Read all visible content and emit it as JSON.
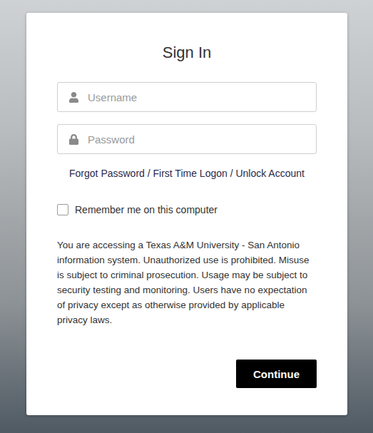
{
  "title": "Sign In",
  "fields": [
    {
      "placeholder": "Username",
      "kind": "user"
    },
    {
      "placeholder": "Password",
      "kind": "password"
    }
  ],
  "help_link": "Forgot Password / First Time Logon / Unlock Account",
  "remember": {
    "label": "Remember me on this computer",
    "checked": false
  },
  "notice": "You are accessing a Texas A&M University - San Antonio information system. Unauthorized use is prohibited. Misuse is subject to criminal prosecution. Usage may be subject to security testing and monitoring. Users have no expectation of privacy except as otherwise provided by applicable privacy laws.",
  "buttons": [
    "Continue"
  ]
}
